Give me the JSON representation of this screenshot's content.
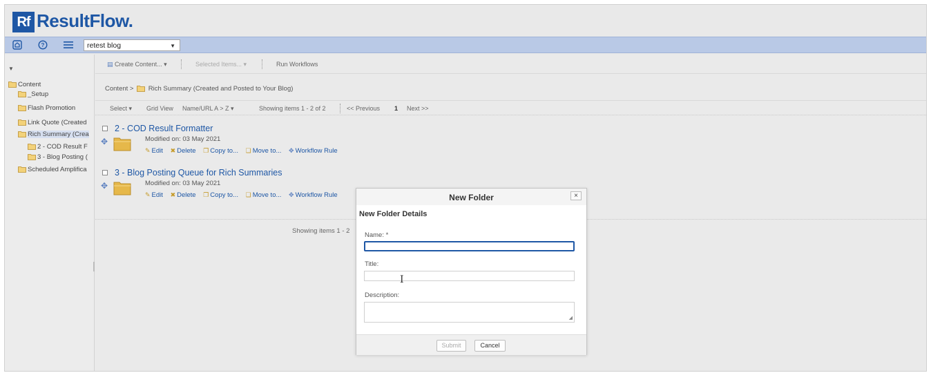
{
  "app": {
    "logo_mark": "Rf",
    "logo_text": "ResultFlow."
  },
  "toolbar": {
    "site_selected": "retest blog"
  },
  "sidebar": {
    "items": [
      {
        "label": "Content"
      },
      {
        "label": "_Setup"
      },
      {
        "label": "Flash Promotion"
      },
      {
        "label": "Link Quote (Created"
      },
      {
        "label": "Rich Summary (Crea"
      },
      {
        "label": "2 - COD Result F"
      },
      {
        "label": "3 - Blog Posting ("
      },
      {
        "label": "Scheduled Amplifica"
      }
    ]
  },
  "actions": {
    "create": "Create Content... ▾",
    "selected": "Selected Items... ▾",
    "run": "Run Workflows"
  },
  "breadcrumb": {
    "root": "Content",
    "sep": ">",
    "current": "Rich Summary (Created and Posted to Your Blog)"
  },
  "list_bar": {
    "select": "Select ▾",
    "grid": "Grid View",
    "sort": "Name/URL A > Z ▾",
    "showing": "Showing items 1 - 2 of 2",
    "prev": "<< Previous",
    "page": "1",
    "next": "Next >>"
  },
  "items": [
    {
      "title": "2 - COD Result Formatter",
      "modified": "Modified on: 03 May 2021",
      "actions": [
        "Edit",
        "Delete",
        "Copy to...",
        "Move to...",
        "Workflow Rule"
      ]
    },
    {
      "title": "3 - Blog Posting Queue for Rich Summaries",
      "modified": "Modified on: 03 May 2021",
      "actions": [
        "Edit",
        "Delete",
        "Copy to...",
        "Move to...",
        "Workflow Rule"
      ]
    }
  ],
  "bottom_showing": "Showing items 1 - 2",
  "modal": {
    "title": "New Folder",
    "close": "×",
    "subtitle": "New Folder Details",
    "name_label": "Name: *",
    "title_label": "Title:",
    "description_label": "Description:",
    "submit": "Submit",
    "cancel": "Cancel"
  },
  "icons": [
    "home-icon",
    "help-icon",
    "menu-icon",
    "folder-icon",
    "edit-icon",
    "delete-icon",
    "copy-icon",
    "move-icon",
    "workflow-icon",
    "drag-icon",
    "close-icon"
  ],
  "colors": {
    "brand": "#1e57a5",
    "toolbar": "#b9c9e6",
    "folder": "#e6b84a"
  }
}
